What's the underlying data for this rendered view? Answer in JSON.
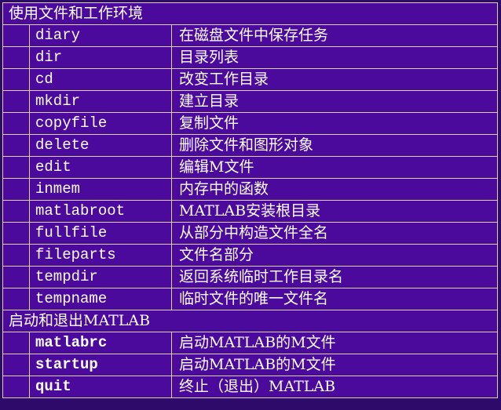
{
  "sections": [
    {
      "title": "使用文件和工作环境",
      "bold_commands": false,
      "rows": [
        {
          "command": "diary",
          "description": "在磁盘文件中保存任务"
        },
        {
          "command": "dir",
          "description": "目录列表"
        },
        {
          "command": "cd",
          "description": "改变工作目录"
        },
        {
          "command": "mkdir",
          "description": "建立目录"
        },
        {
          "command": "copyfile",
          "description": "复制文件"
        },
        {
          "command": "delete",
          "description": "删除文件和图形对象"
        },
        {
          "command": "edit",
          "description": "编辑M文件"
        },
        {
          "command": "inmem",
          "description": "内存中的函数"
        },
        {
          "command": "matlabroot",
          "description": "MATLAB安装根目录"
        },
        {
          "command": "fullfile",
          "description": "从部分中构造文件全名"
        },
        {
          "command": "fileparts",
          "description": "文件名部分"
        },
        {
          "command": "tempdir",
          "description": "返回系统临时工作目录名"
        },
        {
          "command": "tempname",
          "description": "临时文件的唯一文件名"
        }
      ]
    },
    {
      "title": "启动和退出MATLAB",
      "bold_commands": true,
      "rows": [
        {
          "command": "matlabrc",
          "description": "启动MATLAB的M文件"
        },
        {
          "command": "startup",
          "description": "启动MATLAB的M文件"
        },
        {
          "command": "quit",
          "description": "终止（退出）MATLAB"
        }
      ]
    }
  ],
  "colors": {
    "cell_background": "#4b0a9c",
    "page_background": "#2e0a6a",
    "border": "#d8d2b0",
    "text": "#ffffff"
  }
}
